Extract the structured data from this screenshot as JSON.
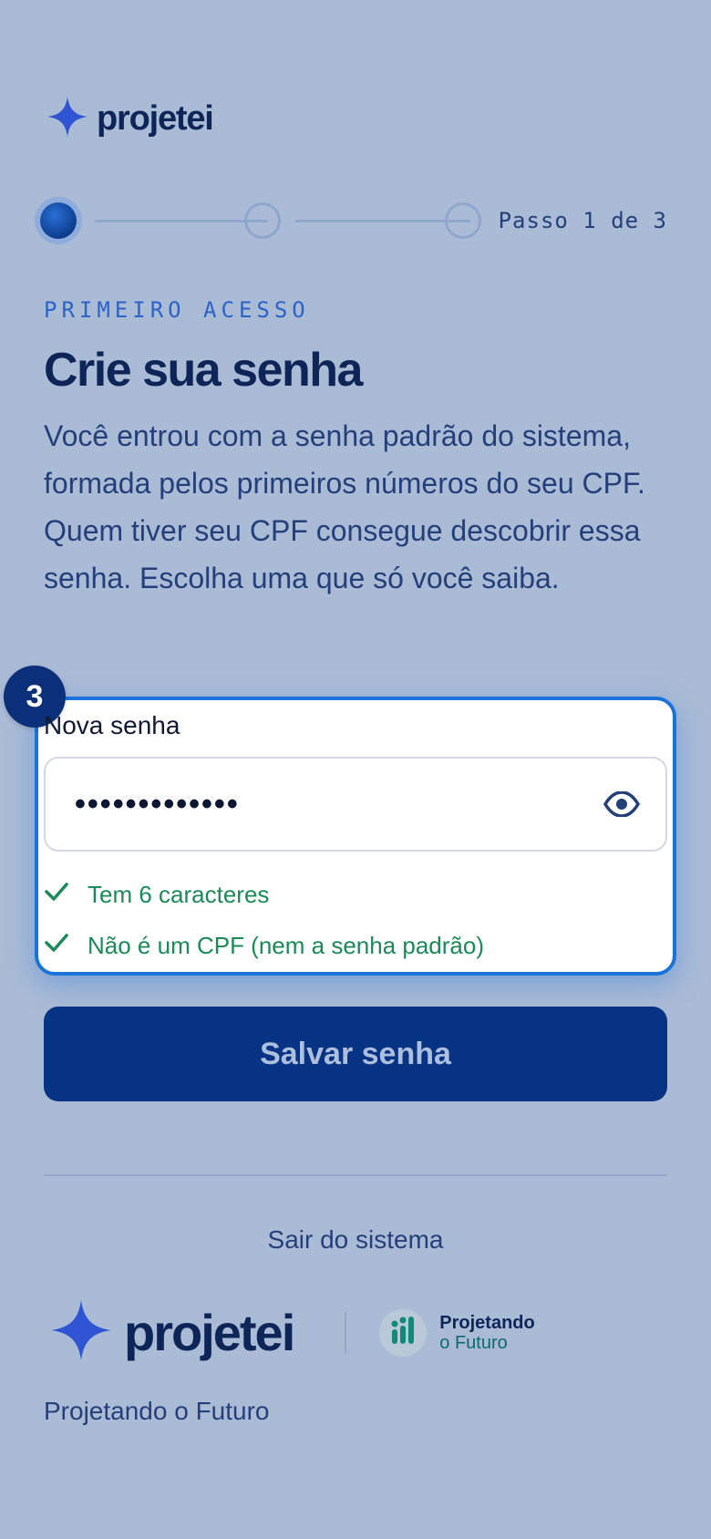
{
  "header": {
    "brand": "projetei"
  },
  "stepper": {
    "progress_text": "Passo 1 de 3",
    "current_step": 1,
    "total_steps": 3
  },
  "intro": {
    "eyebrow": "PRIMEIRO ACESSO",
    "title": "Crie sua senha",
    "description": "Você entrou com a senha padrão do sistema, formada pelos primeiros números do seu CPF. Quem tiver seu CPF consegue descobrir essa senha. Escolha uma que só você saiba."
  },
  "form": {
    "badge_number": "3",
    "password_label": "Nova senha",
    "password_value": "•••••••••••••",
    "rules": [
      {
        "text": "Tem 6 caracteres",
        "status": "ok"
      },
      {
        "text": "Não é um CPF (nem a senha padrão)",
        "status": "ok"
      }
    ],
    "submit_label": "Salvar senha"
  },
  "logout_label": "Sair do sistema",
  "footer": {
    "brand": "projetei",
    "partner_line1": "Projetando",
    "partner_line2": "o Futuro",
    "tagline": "Projetando o Futuro"
  },
  "icons": {
    "brand_mark": "sparkle-star-icon",
    "visibility": "eye-icon",
    "rule_ok": "checkmark-icon",
    "partner": "bar-chart-icon"
  },
  "colors": {
    "background": "#aabbd6",
    "primary": "#063383",
    "accent": "#1a73d9",
    "success": "#1b8a58",
    "brand_star": "#2f55d4"
  }
}
